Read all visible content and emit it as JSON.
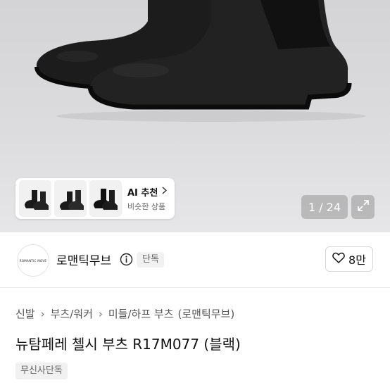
{
  "gallery": {
    "counter": "1 / 24",
    "ai_title": "AI 추천",
    "ai_subtitle": "비슷한 상품",
    "icons": {
      "ai_chevron": "chevron-right-icon",
      "expand": "expand-icon"
    }
  },
  "brand": {
    "logo_text": "ROMANTIC MOVE",
    "name": "로맨틱무브",
    "exclusive_badge": "단독",
    "like_count": "8만"
  },
  "breadcrumb": [
    "신발",
    "부츠/워커",
    "미들/하프 부츠",
    "(로맨틱무브)"
  ],
  "product": {
    "title": "뉴탐페레 첼시 부츠 R17M077 (블랙)",
    "tag": "무신사단독"
  }
}
